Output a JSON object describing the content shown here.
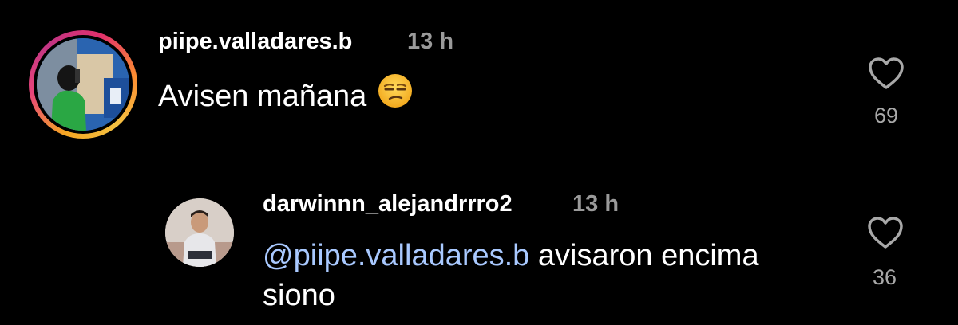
{
  "comments": [
    {
      "username": "piipe.valladares.b",
      "time": "13 h",
      "text": "Avisen mañana",
      "emoji": "unamused-face-emoji",
      "likes": "69",
      "icon": "heart-outline-icon"
    },
    {
      "username": "darwinnn_alejandrrro2",
      "time": "13 h",
      "mention": "@piipe.valladares.b",
      "text_line1": " avisaron encima",
      "text_line2": "siono",
      "likes": "36",
      "icon": "heart-outline-icon"
    }
  ],
  "colors": {
    "background": "#000000",
    "username": "#ffffff",
    "timestamp": "#9a9a9a",
    "mention": "#a9c9ff",
    "like_count": "#a8a8a8"
  }
}
